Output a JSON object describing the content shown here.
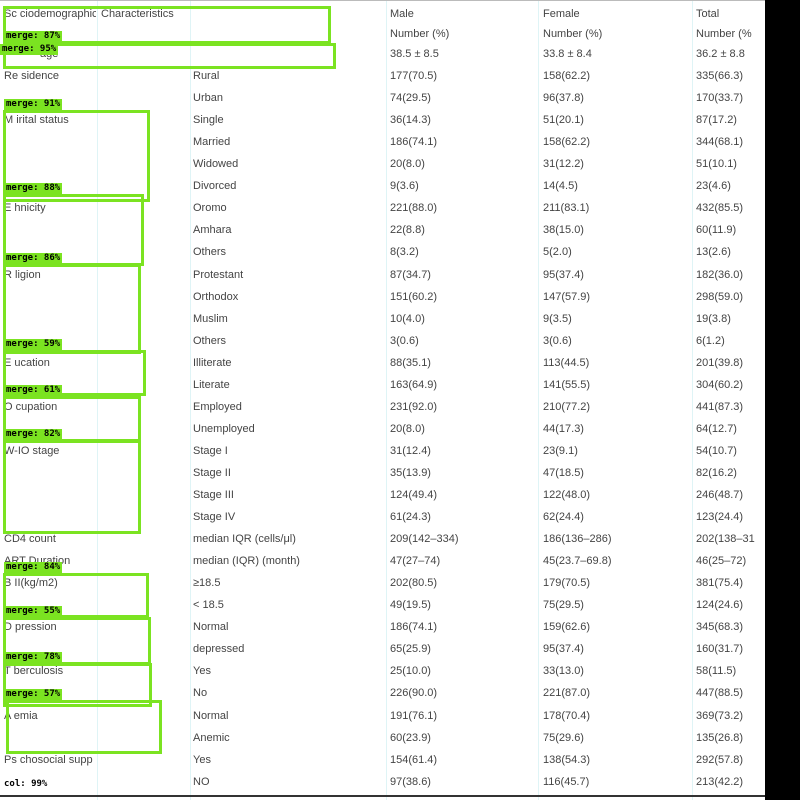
{
  "header": {
    "col0": "Sc ciodemographic",
    "col0b": "Characteristics",
    "col2a": "Male",
    "col2b": "Number (%)",
    "col3a": "Female",
    "col3b": "Number (%)",
    "col4a": "Total",
    "col4b": "Number (%"
  },
  "rows": [
    [
      "age",
      "",
      "38.5 ± 8.5",
      "33.8 ± 8.4",
      "36.2 ± 8.8"
    ],
    [
      "Re sidence",
      "Rural",
      "177(70.5)",
      "158(62.2)",
      "335(66.3)"
    ],
    [
      "",
      "Urban",
      "74(29.5)",
      "96(37.8)",
      "170(33.7)"
    ],
    [
      "M irital status",
      "Single",
      "36(14.3)",
      "51(20.1)",
      "87(17.2)"
    ],
    [
      "",
      "Married",
      "186(74.1)",
      "158(62.2)",
      "344(68.1)"
    ],
    [
      "",
      "Widowed",
      "20(8.0)",
      "31(12.2)",
      "51(10.1)"
    ],
    [
      "",
      "Divorced",
      "9(3.6)",
      "14(4.5)",
      "23(4.6)"
    ],
    [
      "E hnicity",
      "Oromo",
      "221(88.0)",
      "211(83.1)",
      "432(85.5)"
    ],
    [
      "",
      "Amhara",
      "22(8.8)",
      "38(15.0)",
      "60(11.9)"
    ],
    [
      "",
      "Others",
      "8(3.2)",
      "5(2.0)",
      "13(2.6)"
    ],
    [
      "R ligion",
      "Protestant",
      "87(34.7)",
      "95(37.4)",
      "182(36.0)"
    ],
    [
      "",
      "Orthodox",
      "151(60.2)",
      "147(57.9)",
      "298(59.0)"
    ],
    [
      "",
      "Muslim",
      "10(4.0)",
      "9(3.5)",
      "19(3.8)"
    ],
    [
      "",
      "Others",
      "3(0.6)",
      "3(0.6)",
      "6(1.2)"
    ],
    [
      "E ucation",
      "Illiterate",
      "88(35.1)",
      "113(44.5)",
      "201(39.8)"
    ],
    [
      "",
      "Literate",
      "163(64.9)",
      "141(55.5)",
      "304(60.2)"
    ],
    [
      "O cupation",
      "Employed",
      "231(92.0)",
      "210(77.2)",
      "441(87.3)"
    ],
    [
      "",
      "Unemployed",
      "20(8.0)",
      "44(17.3)",
      "64(12.7)"
    ],
    [
      "W-IO stage",
      "Stage I",
      "31(12.4)",
      "23(9.1)",
      "54(10.7)"
    ],
    [
      "",
      "Stage II",
      "35(13.9)",
      "47(18.5)",
      "82(16.2)"
    ],
    [
      "",
      "Stage III",
      "124(49.4)",
      "122(48.0)",
      "246(48.7)"
    ],
    [
      "",
      "Stage IV",
      "61(24.3)",
      "62(24.4)",
      "123(24.4)"
    ],
    [
      "CD4 count",
      "median IQR (cells/μl)",
      "209(142–334)",
      "186(136–286)",
      "202(138–31"
    ],
    [
      "ART Duration",
      "median (IQR) (month)",
      "47(27–74)",
      "45(23.7–69.8)",
      "46(25–72)"
    ],
    [
      "B II(kg/m2)",
      "≥18.5",
      "202(80.5)",
      "179(70.5)",
      "381(75.4)"
    ],
    [
      "",
      "< 18.5",
      "49(19.5)",
      "75(29.5)",
      "124(24.6)"
    ],
    [
      "D pression",
      "Normal",
      "186(74.1)",
      "159(62.6)",
      "345(68.3)"
    ],
    [
      "",
      "depressed",
      "65(25.9)",
      "95(37.4)",
      "160(31.7)"
    ],
    [
      "T berculosis",
      "Yes",
      "25(10.0)",
      "33(13.0)",
      "58(11.5)"
    ],
    [
      "",
      "No",
      "226(90.0)",
      "221(87.0)",
      "447(88.5)"
    ],
    [
      "A emia",
      "Normal",
      "191(76.1)",
      "178(70.4)",
      "369(73.2)"
    ],
    [
      "",
      "Anemic",
      "60(23.9)",
      "75(29.6)",
      "135(26.8)"
    ],
    [
      "Ps chosocial supp",
      "Yes",
      "154(61.4)",
      "138(54.3)",
      "292(57.8)"
    ],
    [
      "",
      "NO",
      "97(38.6)",
      "116(45.7)",
      "213(42.2)"
    ]
  ],
  "overlay_labels": [
    "merge: 87%",
    "merge: 95%",
    "merge: 91%",
    "merge: 88%",
    "merge: 86%",
    "merge: 59%",
    "merge: 61%",
    "merge: 82%",
    "merge: 84%",
    "merge: 55%",
    "merge: 78%",
    "merge: 57%"
  ],
  "col_label": "col: 99%",
  "colors": {
    "overlay": "#7be321",
    "guide": "#dff4f6",
    "text": "#444444"
  }
}
